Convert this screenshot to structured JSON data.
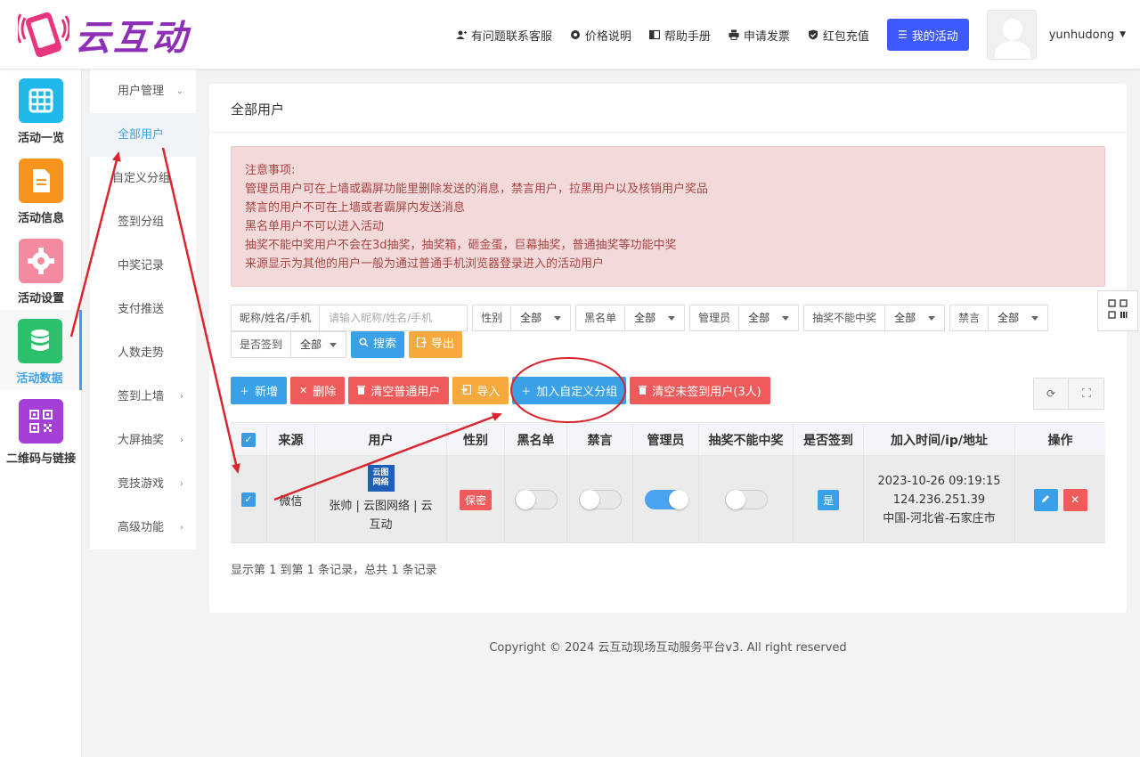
{
  "brand": {
    "name": "云互动"
  },
  "header": {
    "nav": [
      {
        "icon": "user-plus-icon",
        "label": "有问题联系客服"
      },
      {
        "icon": "gear-icon",
        "label": "价格说明"
      },
      {
        "icon": "book-icon",
        "label": "帮助手册"
      },
      {
        "icon": "printer-icon",
        "label": "申请发票"
      },
      {
        "icon": "check-shield-icon",
        "label": "红包充值"
      }
    ],
    "my_activity": "我的活动",
    "username": "yunhudong"
  },
  "rail": [
    {
      "label": "活动一览",
      "icon": "grid-icon",
      "color": "#1fb8e8"
    },
    {
      "label": "活动信息",
      "icon": "document-icon",
      "color": "#f7941d"
    },
    {
      "label": "活动设置",
      "icon": "gear-icon",
      "color": "#f38aa0"
    },
    {
      "label": "活动数据",
      "icon": "database-icon",
      "color": "#2bc16c",
      "active": true
    },
    {
      "label": "二维码与链接",
      "icon": "qrcode-icon",
      "color": "#a53fd8"
    }
  ],
  "submenu": [
    {
      "label": "用户管理",
      "chevron": "down"
    },
    {
      "label": "全部用户",
      "active": true
    },
    {
      "label": "自定义分组"
    },
    {
      "label": "签到分组"
    },
    {
      "label": "中奖记录"
    },
    {
      "label": "支付推送"
    },
    {
      "label": "人数走势"
    },
    {
      "label": "签到上墙",
      "chevron": "right"
    },
    {
      "label": "大屏抽奖",
      "chevron": "right"
    },
    {
      "label": "竞技游戏",
      "chevron": "right"
    },
    {
      "label": "高级功能",
      "chevron": "right"
    }
  ],
  "page": {
    "title": "全部用户",
    "notice": [
      "注意事项:",
      "管理员用户可在上墙或霸屏功能里删除发送的消息，禁言用户，拉黑用户以及核销用户奖品",
      "禁言的用户不可在上墙或者霸屏内发送消息",
      "黑名单用户不可以进入活动",
      "抽奖不能中奖用户不会在3d抽奖，抽奖箱，砸金蛋，巨幕抽奖，普通抽奖等功能中奖",
      "来源显示为其他的用户一般为通过普通手机浏览器登录进入的活动用户"
    ]
  },
  "filters": {
    "name_label": "昵称/姓名/手机",
    "name_placeholder": "请输入昵称/姓名/手机",
    "selects": [
      {
        "label": "性别",
        "value": "全部"
      },
      {
        "label": "黑名单",
        "value": "全部"
      },
      {
        "label": "管理员",
        "value": "全部"
      },
      {
        "label": "抽奖不能中奖",
        "value": "全部"
      },
      {
        "label": "禁言",
        "value": "全部"
      },
      {
        "label": "是否签到",
        "value": "全部"
      }
    ],
    "search_label": "搜索",
    "export_label": "导出"
  },
  "toolbar": {
    "add": "新增",
    "delete": "删除",
    "clear_normal": "清空普通用户",
    "import": "导入",
    "add_group": "加入自定义分组",
    "clear_unsigned": "清空未签到用户(3人)"
  },
  "table": {
    "columns": [
      "来源",
      "用户",
      "性别",
      "黑名单",
      "禁言",
      "管理员",
      "抽奖不能中奖",
      "是否签到",
      "加入时间/ip/地址",
      "操作"
    ],
    "rows": [
      {
        "source": "微信",
        "avatar_text": "云图网络",
        "user": "张帅 | 云图网络 | 云互动",
        "gender": "保密",
        "blacklist": false,
        "muted": false,
        "admin": true,
        "no_prize": false,
        "signed": "是",
        "time": "2023-10-26 09:19:15",
        "ip": "124.236.251.39",
        "location": "中国-河北省-石家庄市"
      }
    ]
  },
  "pagination": {
    "info": "显示第 1 到第 1 条记录，总共 1 条记录"
  },
  "footer": {
    "copyright": "Copyright © 2024 云互动现场互动服务平台v3. All right reserved"
  }
}
